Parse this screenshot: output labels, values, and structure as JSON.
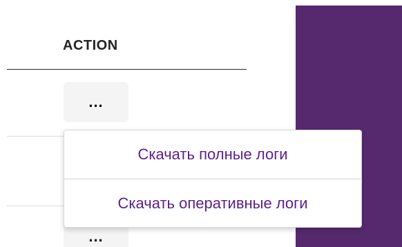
{
  "table": {
    "action_header": "ACTION",
    "rows": [
      {
        "more_label": "..."
      },
      {
        "more_label": "..."
      }
    ]
  },
  "dropdown": {
    "items": [
      {
        "label": "Скачать полные логи"
      },
      {
        "label": "Скачать оперативные логи"
      }
    ]
  },
  "colors": {
    "side_panel": "#56296e",
    "menu_text": "#5b1e8c"
  },
  "icons": {
    "more": "more-horizontal-icon"
  }
}
